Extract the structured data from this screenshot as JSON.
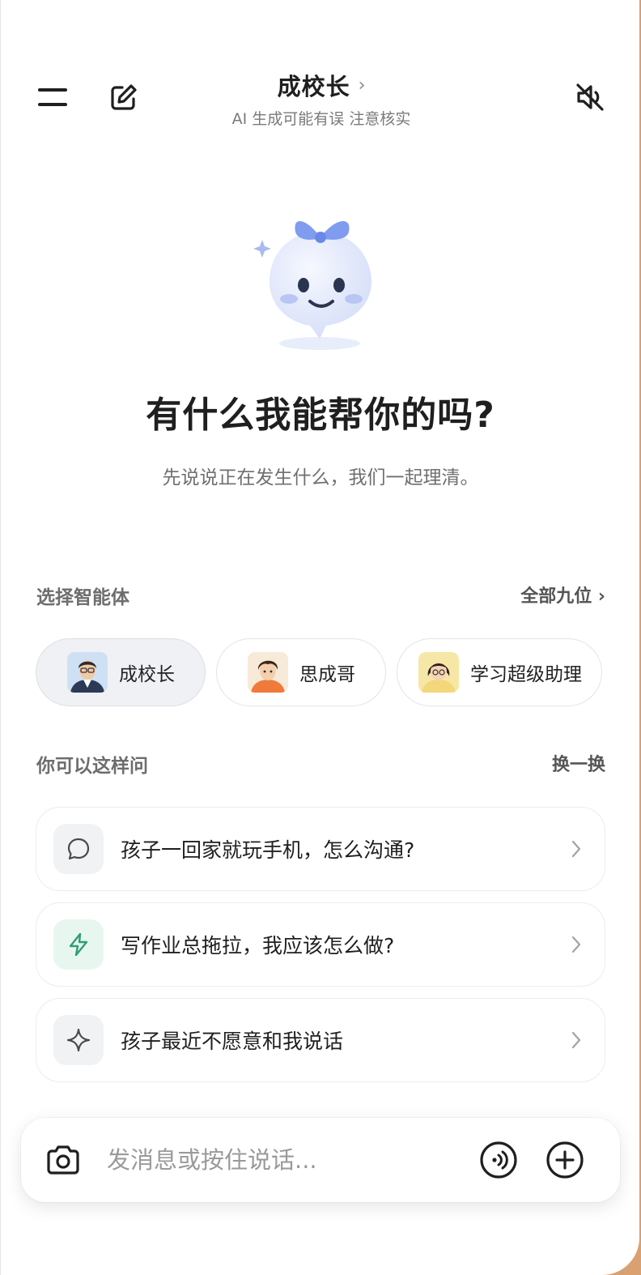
{
  "header": {
    "title": "成校长",
    "title_chevron": "›",
    "subtitle": "AI 生成可能有误 注意核实",
    "icons": [
      "menu-icon",
      "edit-icon",
      "speaker-muted-icon"
    ]
  },
  "hero": {
    "headline": "有什么我能帮你的吗?",
    "subline": "先说说正在发生什么，我们一起理清。"
  },
  "agents_section": {
    "label": "选择智能体",
    "link": "全部九位 ›",
    "items": [
      {
        "name": "成校长",
        "selected": true
      },
      {
        "name": "思成哥",
        "selected": false
      },
      {
        "name": "学习超级助理",
        "selected": false
      }
    ]
  },
  "suggest_section": {
    "label": "你可以这样问",
    "link": "换一换",
    "items": [
      {
        "text": "孩子一回家就玩手机，怎么沟通?",
        "icon": "chat-bubble-icon",
        "icon_bg": "#f1f2f4"
      },
      {
        "text": "写作业总拖拉，我应该怎么做?",
        "icon": "lightning-icon",
        "icon_bg": "#e7f7f0"
      },
      {
        "text": "孩子最近不愿意和我说话",
        "icon": "sparkle-icon",
        "icon_bg": "#f1f2f4"
      }
    ]
  },
  "input": {
    "placeholder": "发消息或按住说话...",
    "value": "",
    "icons": [
      "camera-icon",
      "voice-call-icon",
      "plus-icon"
    ]
  },
  "colors": {
    "accent_green": "#2f9e73",
    "mascot_blue": "#dde6fb",
    "bow_blue": "#7f9cf0"
  }
}
